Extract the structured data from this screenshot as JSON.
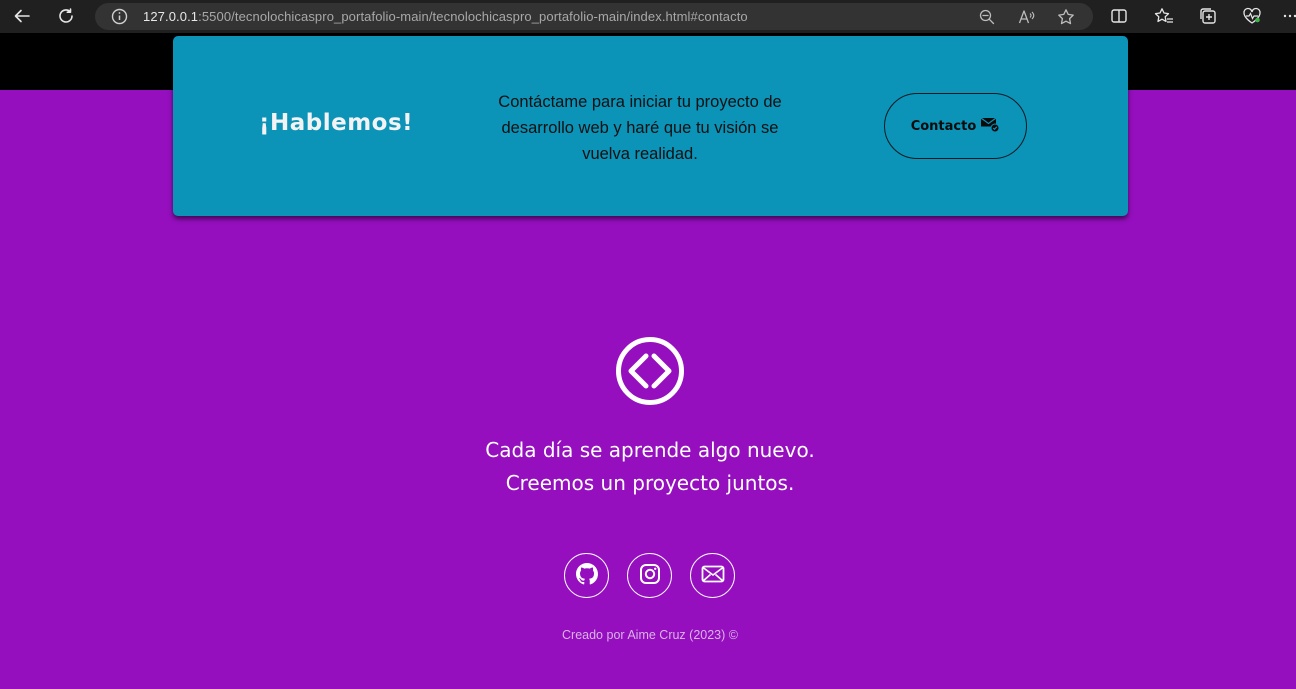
{
  "browser": {
    "url_host": "127.0.0.1",
    "url_rest": ":5500/tecnolochicaspro_portafolio-main/tecnolochicaspro_portafolio-main/index.html#contacto",
    "icons": [
      "back-arrow-icon",
      "reload-icon",
      "site-info-icon",
      "zoom-out-icon",
      "read-aloud-icon",
      "favorite-star-icon",
      "split-screen-icon",
      "favorites-icon",
      "collections-icon",
      "browser-essentials-icon",
      "more-icon"
    ]
  },
  "cta": {
    "title": "¡Hablemos!",
    "text": "Contáctame para iniciar tu proyecto de desarrollo web y haré que tu visión se vuelva realidad.",
    "button_label": "Contacto"
  },
  "footer": {
    "tagline_line1": "Cada día se aprende algo nuevo.",
    "tagline_line2": "Creemos un proyecto juntos.",
    "credit": "Creado por Aime Cruz (2023) ©"
  },
  "colors": {
    "page_bg": "#950fbe",
    "cta_bg": "#0b93b8",
    "header_bg": "#000000"
  }
}
